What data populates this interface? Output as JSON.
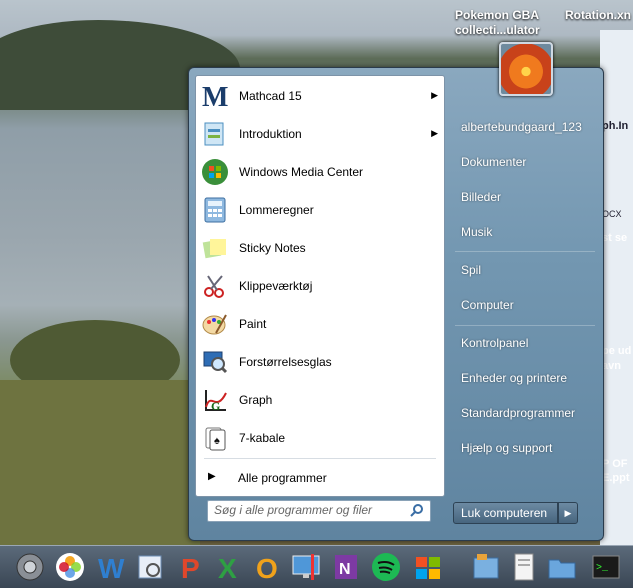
{
  "desktop": {
    "icons": [
      {
        "label_line1": "Pokemon GBA",
        "label_line2": "collecti...ulator"
      },
      {
        "label_line1": "Rotation.xn",
        "label_line2": ""
      }
    ],
    "right_fragments": [
      "ph.In",
      "OCX",
      "st se",
      "pe ud",
      "avn",
      "P OF",
      "E.ppt"
    ]
  },
  "start_menu": {
    "programs": [
      {
        "label": "Mathcad 15",
        "icon": "mathcad-icon",
        "has_submenu": true
      },
      {
        "label": "Introduktion",
        "icon": "introduction-icon",
        "has_submenu": true
      },
      {
        "label": "Windows Media Center",
        "icon": "media-center-icon",
        "has_submenu": false
      },
      {
        "label": "Lommeregner",
        "icon": "calculator-icon",
        "has_submenu": false
      },
      {
        "label": "Sticky Notes",
        "icon": "sticky-notes-icon",
        "has_submenu": false
      },
      {
        "label": "Klippeværktøj",
        "icon": "snipping-tool-icon",
        "has_submenu": false
      },
      {
        "label": "Paint",
        "icon": "paint-icon",
        "has_submenu": false
      },
      {
        "label": "Forstørrelsesglas",
        "icon": "magnifier-icon",
        "has_submenu": false
      },
      {
        "label": "Graph",
        "icon": "graph-icon",
        "has_submenu": false
      },
      {
        "label": "7-kabale",
        "icon": "solitaire-icon",
        "has_submenu": false
      }
    ],
    "all_programs": "Alle programmer",
    "search_placeholder": "Søg i alle programmer og filer",
    "right_items": [
      {
        "label": "albertebundgaard_123"
      },
      {
        "label": "Dokumenter"
      },
      {
        "label": "Billeder"
      },
      {
        "label": "Musik"
      },
      {
        "label": "Spil"
      },
      {
        "label": "Computer"
      },
      {
        "label": "Kontrolpanel"
      },
      {
        "label": "Enheder og printere"
      },
      {
        "label": "Standardprogrammer"
      },
      {
        "label": "Hjælp og support"
      }
    ],
    "shutdown_label": "Luk computeren"
  },
  "taskbar": {
    "icons": [
      "system-preferences-icon",
      "photos-icon",
      "word-icon",
      "preview-icon",
      "powerpoint-icon",
      "excel-icon",
      "outlook-icon",
      "remote-desktop-icon",
      "onenote-icon",
      "spotify-icon",
      "windows-logo-icon",
      "documents-icon",
      "docx-file-icon",
      "folder-icon",
      "terminal-icon"
    ]
  },
  "colors": {
    "menu_blue": "#7397b1",
    "taskbar": "#3a4654"
  }
}
